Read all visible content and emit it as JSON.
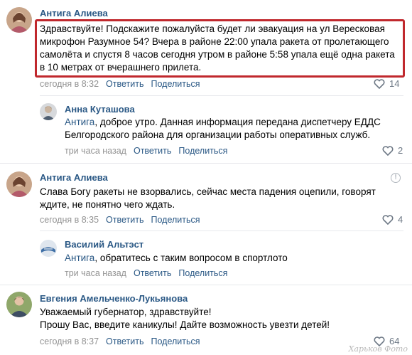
{
  "comments": [
    {
      "author": "Антига Алиева",
      "text": "Здравствуйте! Подскажите пожалуйста будет ли эвакуация на ул Вересковая микрофон Разумное 54? Вчера в районе 22:00 упала ракета от пролетающего самолёта и спустя 8 часов сегодня утром в районе 5:58 упала ещё одна ракета в 10 метрах от вчерашнего прилета.",
      "time": "сегодня в 8:32",
      "reply_label": "Ответить",
      "share_label": "Поделиться",
      "likes": "14"
    },
    {
      "author": "Анна Куташова",
      "mention": "Антига",
      "text": ", доброе утро. Данная информация передана диспетчеру ЕДДС Белгородского района для организации работы оперативных служб.",
      "time": "три часа назад",
      "reply_label": "Ответить",
      "share_label": "Поделиться",
      "likes": "2"
    },
    {
      "author": "Антига Алиева",
      "text": "Слава Богу ракеты не взорвались, сейчас места падения оцепили, говорят ждите, не понятно чего ждать.",
      "time": "сегодня в 8:35",
      "reply_label": "Ответить",
      "share_label": "Поделиться",
      "likes": "4"
    },
    {
      "author": "Василий Альтэст",
      "mention": "Антига",
      "text": ", обратитесь с таким вопросом в спортлото",
      "time": "три часа назад",
      "reply_label": "Ответить",
      "share_label": "Поделиться"
    },
    {
      "author": "Евгения Амельченко-Лукьянова",
      "text_line1": "Уважаемый губернатор, здравствуйте!",
      "text_line2": "Прошу Вас, введите каникулы! Дайте возможность увезти детей!",
      "time": "сегодня в 8:37",
      "reply_label": "Ответить",
      "share_label": "Поделиться",
      "likes": "64"
    }
  ],
  "watermark": "Харьков Фото",
  "colors": {
    "link": "#2a5885",
    "meta": "#939393",
    "highlight": "#c0282d"
  }
}
